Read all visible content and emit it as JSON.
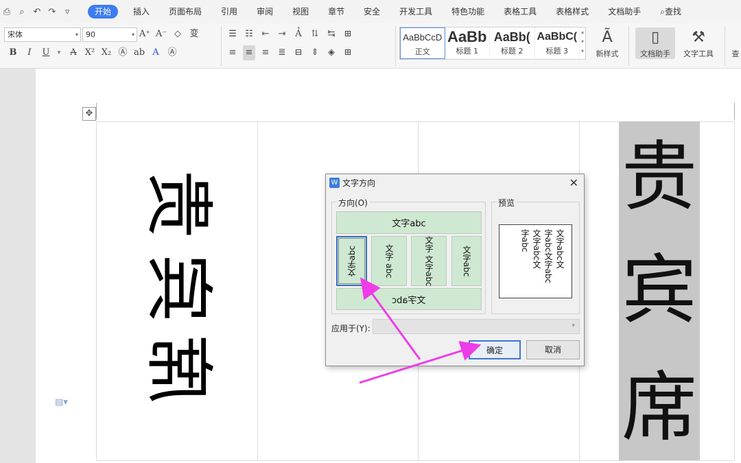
{
  "menu": {
    "tabs": [
      "开始",
      "插入",
      "页面布局",
      "引用",
      "审阅",
      "视图",
      "章节",
      "安全",
      "开发工具",
      "特色功能",
      "表格工具",
      "表格样式",
      "文档助手"
    ],
    "active_tab": "开始",
    "search_label": "查找"
  },
  "ribbon": {
    "font_name": "宋体",
    "font_size": "90",
    "styles": [
      {
        "preview": "AaBbCcD",
        "name": "正文"
      },
      {
        "preview": "AaBb",
        "name": "标题 1"
      },
      {
        "preview": "AaBb(",
        "name": "标题 2"
      },
      {
        "preview": "AaBbC(",
        "name": "标题 3"
      }
    ],
    "new_style_label": "新样式",
    "doc_assistant_label": "文档助手",
    "text_tools_label": "文字工具",
    "search_short": "查"
  },
  "document": {
    "rotated_chars": [
      "贵",
      "宾",
      "席"
    ],
    "highlight_chars": [
      "贵",
      "宾",
      "席"
    ]
  },
  "dialog": {
    "title": "文字方向",
    "direction_group": "方向(O)",
    "preview_group": "预览",
    "options": {
      "horizontal": "文字abc",
      "vert1": "文字abc",
      "vert2_a": "文字",
      "vert2_b": "abc",
      "vert3_a": "文字",
      "vert3_b": "文字abc",
      "vert4": "文字abc",
      "bottom": "文字abc"
    },
    "preview_cols": [
      "文字abc文",
      "字abc文字abc",
      "文字abc文",
      "字abc"
    ],
    "apply_label": "应用于(Y):",
    "ok_label": "确定",
    "cancel_label": "取消"
  },
  "colors": {
    "accent": "#3d7cf0",
    "option_fill": "#cfe8d2",
    "annotation_arrow": "#ee3de8",
    "highlight": "#c7c7c7"
  }
}
